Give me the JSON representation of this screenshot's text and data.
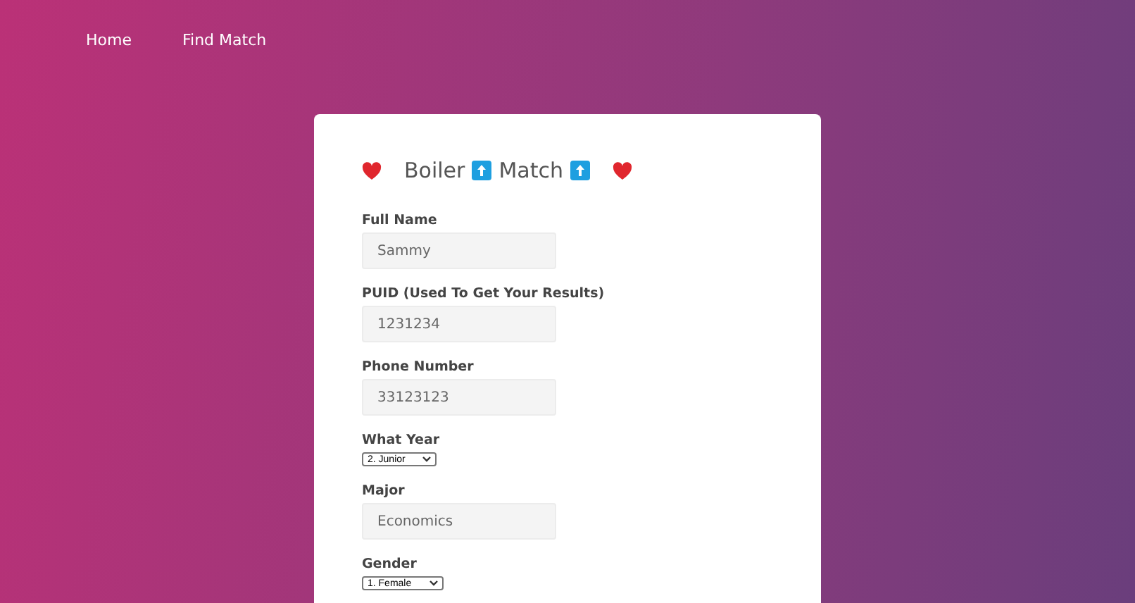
{
  "nav": [
    {
      "label": "Home"
    },
    {
      "label": "Find Match"
    }
  ],
  "form": {
    "title": [
      "Boiler",
      "Match"
    ],
    "fields": [
      {
        "kind": "text",
        "label": "Full Name",
        "value": "Sammy"
      },
      {
        "kind": "text",
        "label": "PUID (Used To Get Your Results)",
        "value": "1231234"
      },
      {
        "kind": "text",
        "label": "Phone Number",
        "value": "33123123"
      },
      {
        "kind": "select",
        "label": "What Year",
        "value": "2. Junior"
      },
      {
        "kind": "text",
        "label": "Major",
        "value": "Economics"
      },
      {
        "kind": "select",
        "label": "Gender",
        "value": "1. Female"
      }
    ]
  }
}
